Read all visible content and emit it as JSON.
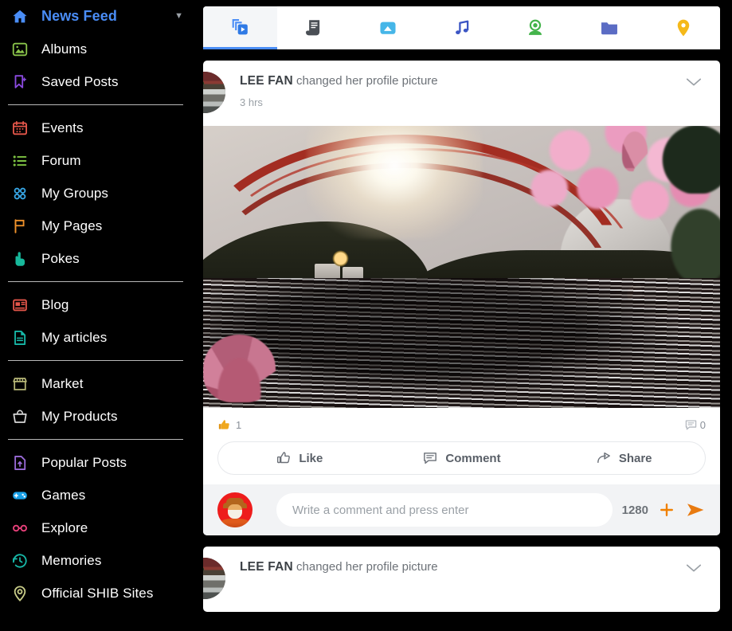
{
  "sidebar": {
    "groups": [
      {
        "items": [
          {
            "label": "News Feed",
            "icon": "home-icon",
            "color": "#4a8df6",
            "active": true,
            "chevron": "▼"
          },
          {
            "label": "Albums",
            "icon": "photo-album-icon",
            "color": "#8ac44a",
            "active": false
          },
          {
            "label": "Saved Posts",
            "icon": "bookmark-plus-icon",
            "color": "#8b4ae0",
            "active": false
          }
        ]
      },
      {
        "items": [
          {
            "label": "Events",
            "icon": "calendar-icon",
            "color": "#e4564a",
            "active": false
          },
          {
            "label": "Forum",
            "icon": "list-icon",
            "color": "#7dc242",
            "active": false
          },
          {
            "label": "My Groups",
            "icon": "groups-icon",
            "color": "#38a8e8",
            "active": false
          },
          {
            "label": "My Pages",
            "icon": "flag-icon",
            "color": "#f0922b",
            "active": false
          },
          {
            "label": "Pokes",
            "icon": "poke-hand-icon",
            "color": "#17b89b",
            "active": false
          }
        ]
      },
      {
        "items": [
          {
            "label": "Blog",
            "icon": "blog-icon",
            "color": "#e4564a",
            "active": false
          },
          {
            "label": "My articles",
            "icon": "article-icon",
            "color": "#17b8a8",
            "active": false
          }
        ]
      },
      {
        "items": [
          {
            "label": "Market",
            "icon": "store-icon",
            "color": "#b8b878",
            "active": false
          },
          {
            "label": "My Products",
            "icon": "basket-icon",
            "color": "#d8d8d8",
            "active": false
          }
        ]
      },
      {
        "items": [
          {
            "label": "Popular Posts",
            "icon": "popular-posts-icon",
            "color": "#9a6bd8",
            "active": false
          },
          {
            "label": "Games",
            "icon": "gamepad-icon",
            "color": "#18a0e8",
            "active": false
          },
          {
            "label": "Explore",
            "icon": "glasses-icon",
            "color": "#e8407a",
            "active": false
          },
          {
            "label": "Memories",
            "icon": "history-clock-icon",
            "color": "#17b8a8",
            "active": false
          },
          {
            "label": "Official SHIB Sites",
            "icon": "location-pin-icon",
            "color": "#c8cc88",
            "active": false
          }
        ]
      }
    ]
  },
  "tabs": [
    {
      "name": "videos-tab",
      "icon": "video-slides-icon",
      "color": "#4a8df6",
      "selected": true
    },
    {
      "name": "articles-tab",
      "icon": "scroll-document-icon",
      "color": "#4a4f55",
      "selected": false
    },
    {
      "name": "photos-tab",
      "icon": "photo-icon",
      "color": "#46b6e8",
      "selected": false
    },
    {
      "name": "music-tab",
      "icon": "music-note-icon",
      "color": "#3b55c4",
      "selected": false
    },
    {
      "name": "live-tab",
      "icon": "webcam-icon",
      "color": "#43b34a",
      "selected": false
    },
    {
      "name": "files-tab",
      "icon": "folder-icon",
      "color": "#5b6cc4",
      "selected": false
    },
    {
      "name": "places-tab",
      "icon": "map-pin-icon",
      "color": "#f5b91a",
      "selected": false
    }
  ],
  "posts": [
    {
      "author": "LEE FAN",
      "action": "changed her profile picture",
      "time": "3 hrs",
      "like_count": "1",
      "comment_count": "0",
      "actions": [
        {
          "label": "Like",
          "icon": "thumbs-up-outline-icon"
        },
        {
          "label": "Comment",
          "icon": "comment-bubble-icon"
        },
        {
          "label": "Share",
          "icon": "share-arrow-icon"
        }
      ],
      "comment_placeholder": "Write a comment and press enter",
      "char_limit": "1280"
    },
    {
      "author": "LEE FAN",
      "action": "changed her profile picture"
    }
  ],
  "colors": {
    "accent_blue": "#4a8df6",
    "orange": "#f08000",
    "sidebar_bg": "#000000",
    "card_bg": "#ffffff",
    "text_muted": "#9aa0a6"
  }
}
